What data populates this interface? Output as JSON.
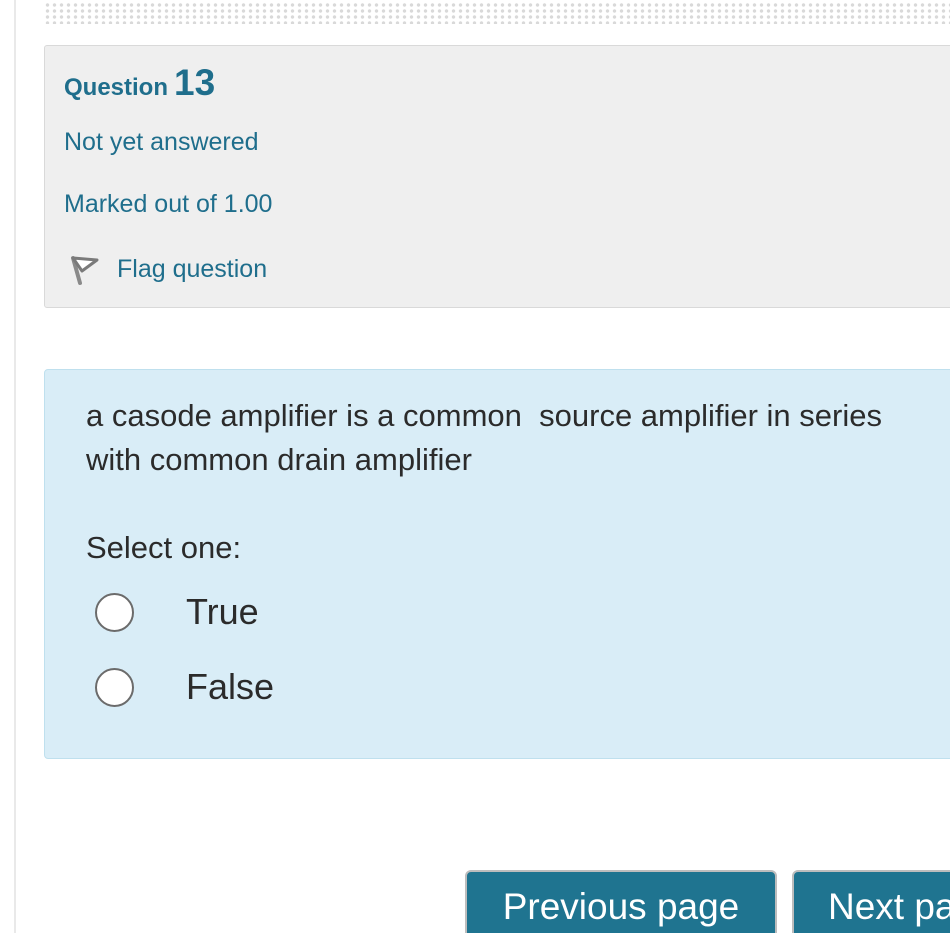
{
  "question": {
    "label": "Question",
    "number": "13",
    "state": "Not yet answered",
    "grade": "Marked out of 1.00",
    "flag_label": "Flag question",
    "flag_icon": "flag-outline-icon"
  },
  "content": {
    "text": "a casode amplifier is a common  source amplifier in series with common drain amplifier",
    "prompt": "Select one:",
    "answers": [
      {
        "label": "True",
        "selected": false
      },
      {
        "label": "False",
        "selected": false
      }
    ]
  },
  "navigation": {
    "previous_label": "Previous page",
    "next_label": "Next page"
  },
  "colors": {
    "accent": "#1f6e8c",
    "info_background": "#efefef",
    "content_background": "#d9edf7",
    "button_background": "#1f7490",
    "button_text": "#ffffff"
  }
}
